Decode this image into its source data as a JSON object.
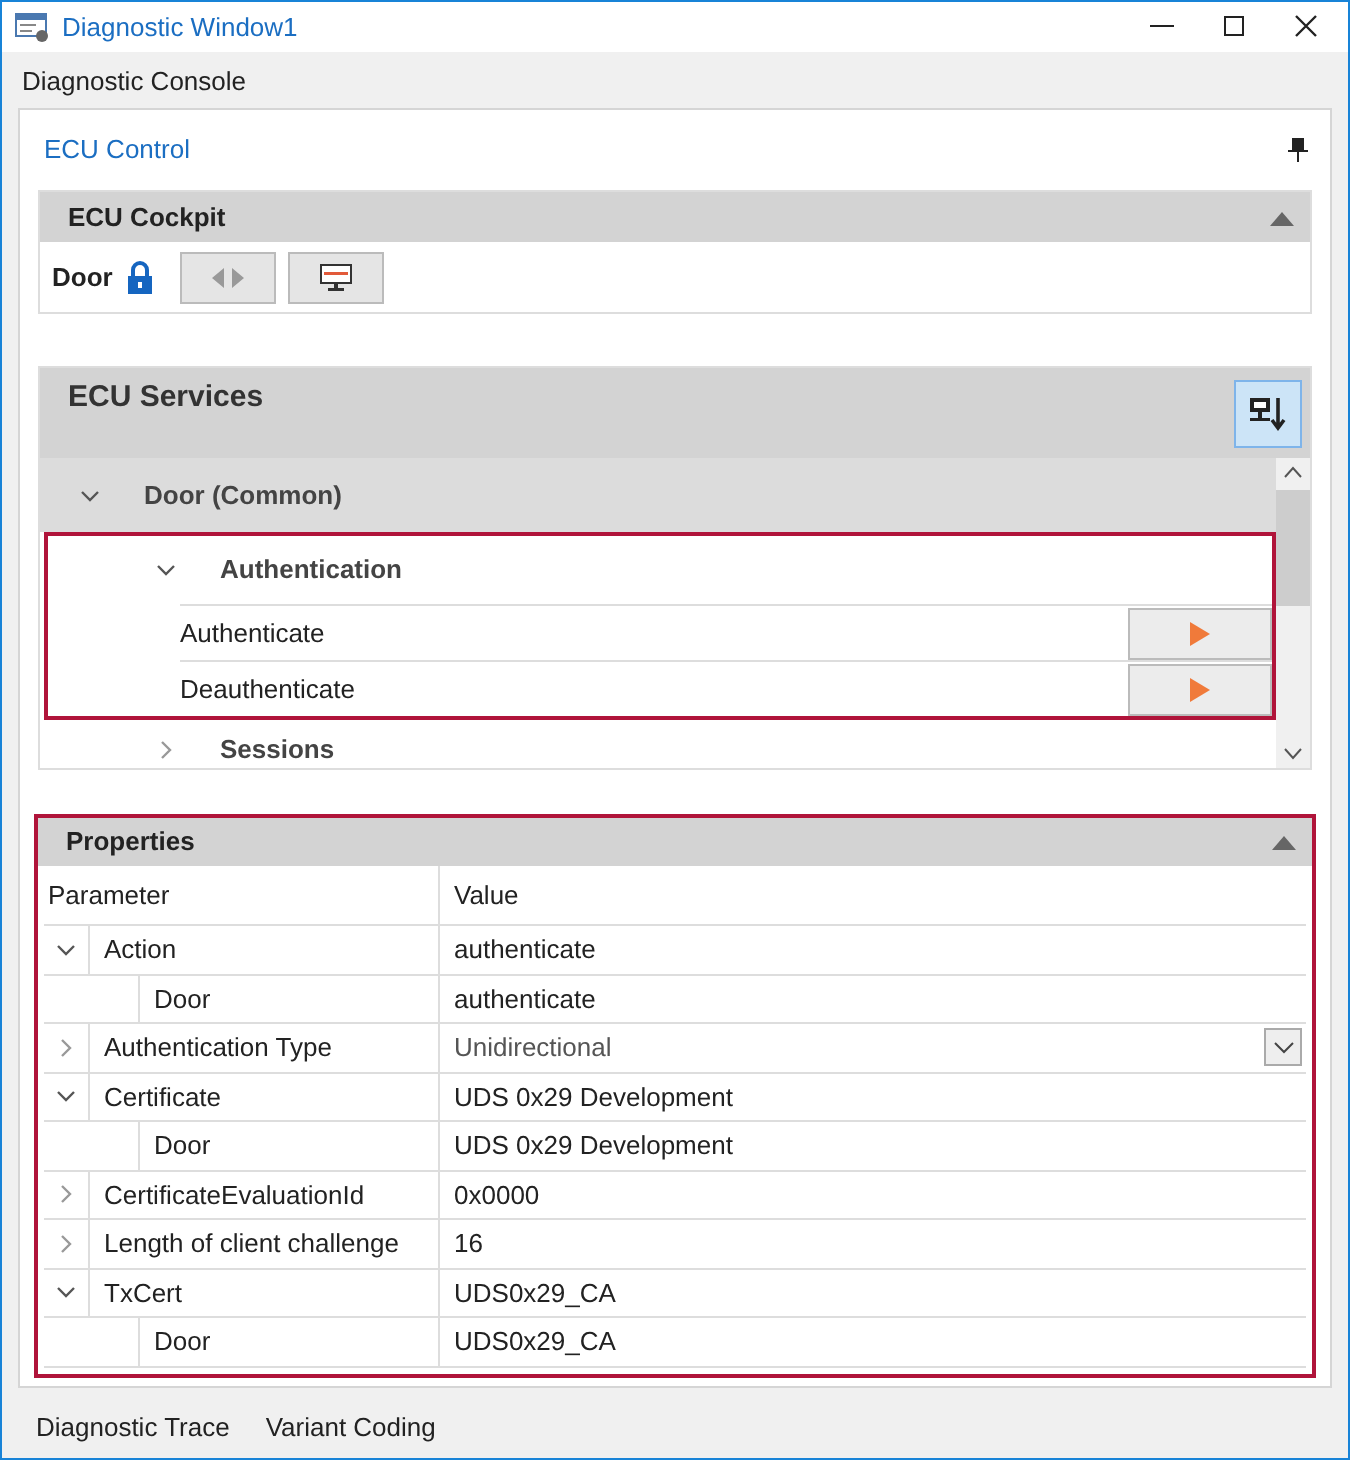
{
  "window": {
    "title": "Diagnostic Window1"
  },
  "console_tab": "Diagnostic Console",
  "ecu_control": {
    "title": "ECU Control"
  },
  "ecu_cockpit": {
    "title": "ECU Cockpit",
    "expanded": true,
    "device": "Door",
    "locked": true
  },
  "ecu_services": {
    "title": "ECU Services",
    "tree": [
      {
        "label": "Door (Common)",
        "expanded": true,
        "highlighted": false,
        "children": [
          {
            "label": "Authentication",
            "expanded": true,
            "highlighted": true,
            "children": [
              {
                "label": "Authenticate"
              },
              {
                "label": "Deauthenticate"
              }
            ]
          },
          {
            "label": "Sessions",
            "expanded": false,
            "highlighted": false
          }
        ]
      }
    ]
  },
  "properties": {
    "title": "Properties",
    "expanded": true,
    "highlighted": true,
    "columns": [
      "Parameter",
      "Value"
    ],
    "rows": [
      {
        "parameter": "Action",
        "value": "authenticate",
        "expanded": true,
        "children": [
          {
            "parameter": "Door",
            "value": "authenticate"
          }
        ]
      },
      {
        "parameter": "Authentication Type",
        "value": "Unidirectional",
        "expanded": false,
        "dropdown": true
      },
      {
        "parameter": "Certificate",
        "value": "UDS 0x29 Development",
        "expanded": true,
        "children": [
          {
            "parameter": "Door",
            "value": "UDS 0x29 Development"
          }
        ]
      },
      {
        "parameter": "CertificateEvaluationId",
        "value": "0x0000",
        "expanded": false
      },
      {
        "parameter": "Length of client challenge",
        "value": "16",
        "expanded": false
      },
      {
        "parameter": "TxCert",
        "value": "UDS0x29_CA",
        "expanded": true,
        "children": [
          {
            "parameter": "Door",
            "value": "UDS0x29_CA"
          }
        ]
      }
    ]
  },
  "bottom_tabs": [
    "Diagnostic Trace",
    "Variant Coding"
  ]
}
